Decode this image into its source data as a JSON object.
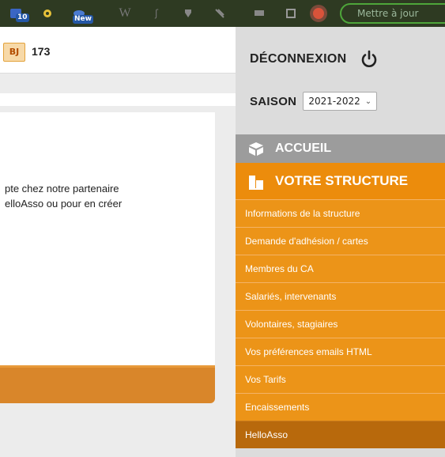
{
  "toolbar": {
    "badge_count": "10",
    "new_badge": "New",
    "update_button": "Mettre à jour",
    "icons": [
      "house-icon",
      "gear-icon",
      "new-icon",
      "wordpress-icon",
      "plugin-icon",
      "pin-icon",
      "comment-icon",
      "media-icon",
      "page-icon",
      "user-badge-icon"
    ]
  },
  "stats": {
    "bj_icon_label": "BJ",
    "count": "173"
  },
  "card": {
    "line1": "pte chez notre partenaire",
    "line2": "elloAsso ou pour en créer"
  },
  "sidebar": {
    "logout_label": "DÉCONNEXION",
    "season_label": "SAISON",
    "season_value": "2021-2022",
    "accueil_label": "ACCUEIL",
    "structure_label": "VOTRE STRUCTURE",
    "items": [
      {
        "label": "Informations de la structure"
      },
      {
        "label": "Demande d'adhésion / cartes"
      },
      {
        "label": "Membres du CA"
      },
      {
        "label": "Salariés, intervenants"
      },
      {
        "label": "Volontaires, stagiaires"
      },
      {
        "label": "Vos préférences emails HTML"
      },
      {
        "label": "Vos Tarifs"
      },
      {
        "label": "Encaissements"
      },
      {
        "label": "HelloAsso"
      }
    ]
  },
  "colors": {
    "accent_orange": "#ec9418",
    "active_item": "#b8690c",
    "accueil_gray": "#9c9c9c",
    "toolbar_dark": "#2e3a22"
  }
}
